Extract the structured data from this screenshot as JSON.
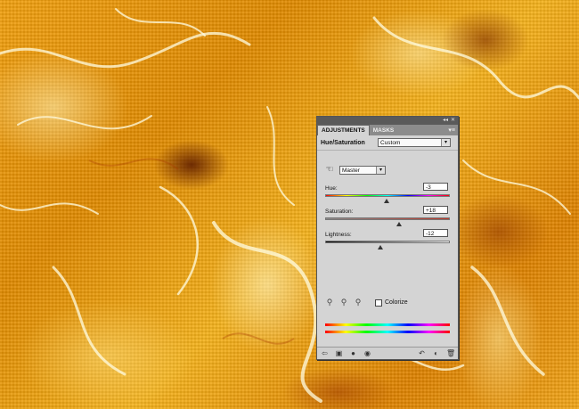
{
  "panel": {
    "tabs": [
      {
        "label": "ADJUSTMENTS",
        "active": true
      },
      {
        "label": "MASKS",
        "active": false
      }
    ],
    "title": "Hue/Saturation",
    "preset": "Custom",
    "channel": "Master",
    "sliders": {
      "hue": {
        "label": "Hue:",
        "value": "-3",
        "level": -3,
        "min": -180,
        "max": 180
      },
      "saturation": {
        "label": "Saturation:",
        "value": "+18",
        "level": 18,
        "min": -100,
        "max": 100
      },
      "lightness": {
        "label": "Lightness:",
        "value": "-12",
        "level": -12,
        "min": -100,
        "max": 100
      }
    },
    "colorize_label": "Colorize",
    "colorize_checked": false
  },
  "icons": {
    "collapse": "double-chevron-icon",
    "close": "close-icon",
    "panel_menu": "panel-menu-icon",
    "hand_tool": "targeted-adjustment-hand-icon",
    "eyedroppers": [
      "eyedropper-icon",
      "eyedropper-plus-icon",
      "eyedropper-minus-icon"
    ],
    "bottom_left": [
      "back-arrow-icon",
      "expand-view-icon",
      "clip-to-layer-icon",
      "visibility-eye-icon"
    ],
    "bottom_right": [
      "view-previous-icon",
      "reset-icon",
      "delete-icon"
    ]
  },
  "colors": {
    "panel_bg": "#d4d4d4",
    "canvas_fire": "#f0a010"
  }
}
